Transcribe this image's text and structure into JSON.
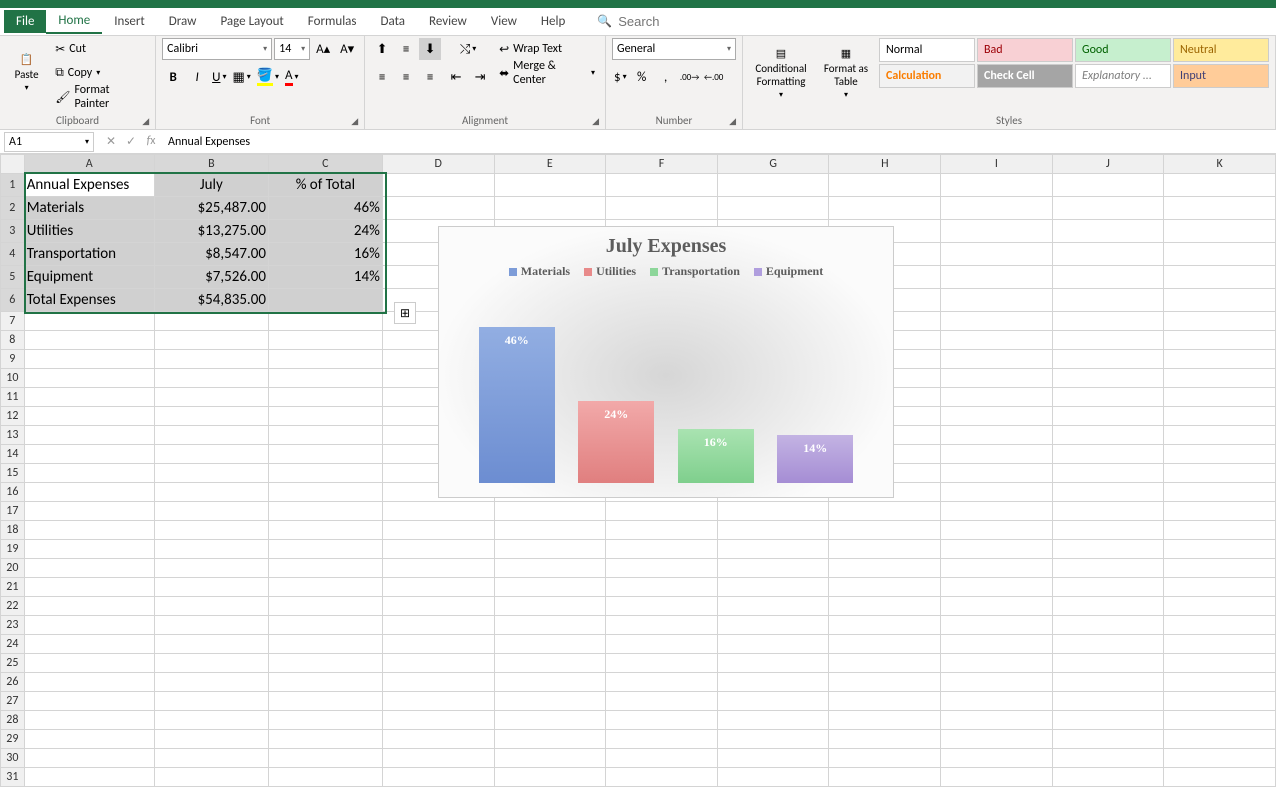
{
  "tabs": {
    "file": "File",
    "home": "Home",
    "insert": "Insert",
    "draw": "Draw",
    "pagelayout": "Page Layout",
    "formulas": "Formulas",
    "data": "Data",
    "review": "Review",
    "view": "View",
    "help": "Help"
  },
  "search_placeholder": "Search",
  "clipboard": {
    "paste": "Paste",
    "cut": "Cut",
    "copy": "Copy",
    "fp": "Format Painter",
    "label": "Clipboard"
  },
  "font": {
    "name": "Calibri",
    "size": "14",
    "label": "Font"
  },
  "alignment": {
    "wrap": "Wrap Text",
    "merge": "Merge & Center",
    "label": "Alignment"
  },
  "number": {
    "format": "General",
    "label": "Number"
  },
  "styles": {
    "cond": "Conditional Formatting",
    "fat": "Format as Table",
    "normal": "Normal",
    "bad": "Bad",
    "good": "Good",
    "neutral": "Neutral",
    "calc": "Calculation",
    "check": "Check Cell",
    "explan": "Explanatory ...",
    "input": "Input",
    "label": "Styles"
  },
  "name_box": "A1",
  "formula": "Annual Expenses",
  "table": {
    "headers": [
      "Annual Expenses",
      "July",
      "% of Total"
    ],
    "rows": [
      [
        "Materials",
        "$25,487.00",
        "46%"
      ],
      [
        "Utilities",
        "$13,275.00",
        "24%"
      ],
      [
        "Transportation",
        "$8,547.00",
        "16%"
      ],
      [
        "Equipment",
        "$7,526.00",
        "14%"
      ]
    ],
    "total": [
      "Total Expenses",
      "$54,835.00",
      ""
    ]
  },
  "chart_data": {
    "type": "bar",
    "title": "July Expenses",
    "categories": [
      "Materials",
      "Utilities",
      "Transportation",
      "Equipment"
    ],
    "values": [
      46,
      24,
      16,
      14
    ],
    "labels": [
      "46%",
      "24%",
      "16%",
      "14%"
    ],
    "colors": [
      "#7d9cd8",
      "#e88a8a",
      "#8dd69a",
      "#b09ede"
    ],
    "ylim": [
      0,
      50
    ]
  }
}
